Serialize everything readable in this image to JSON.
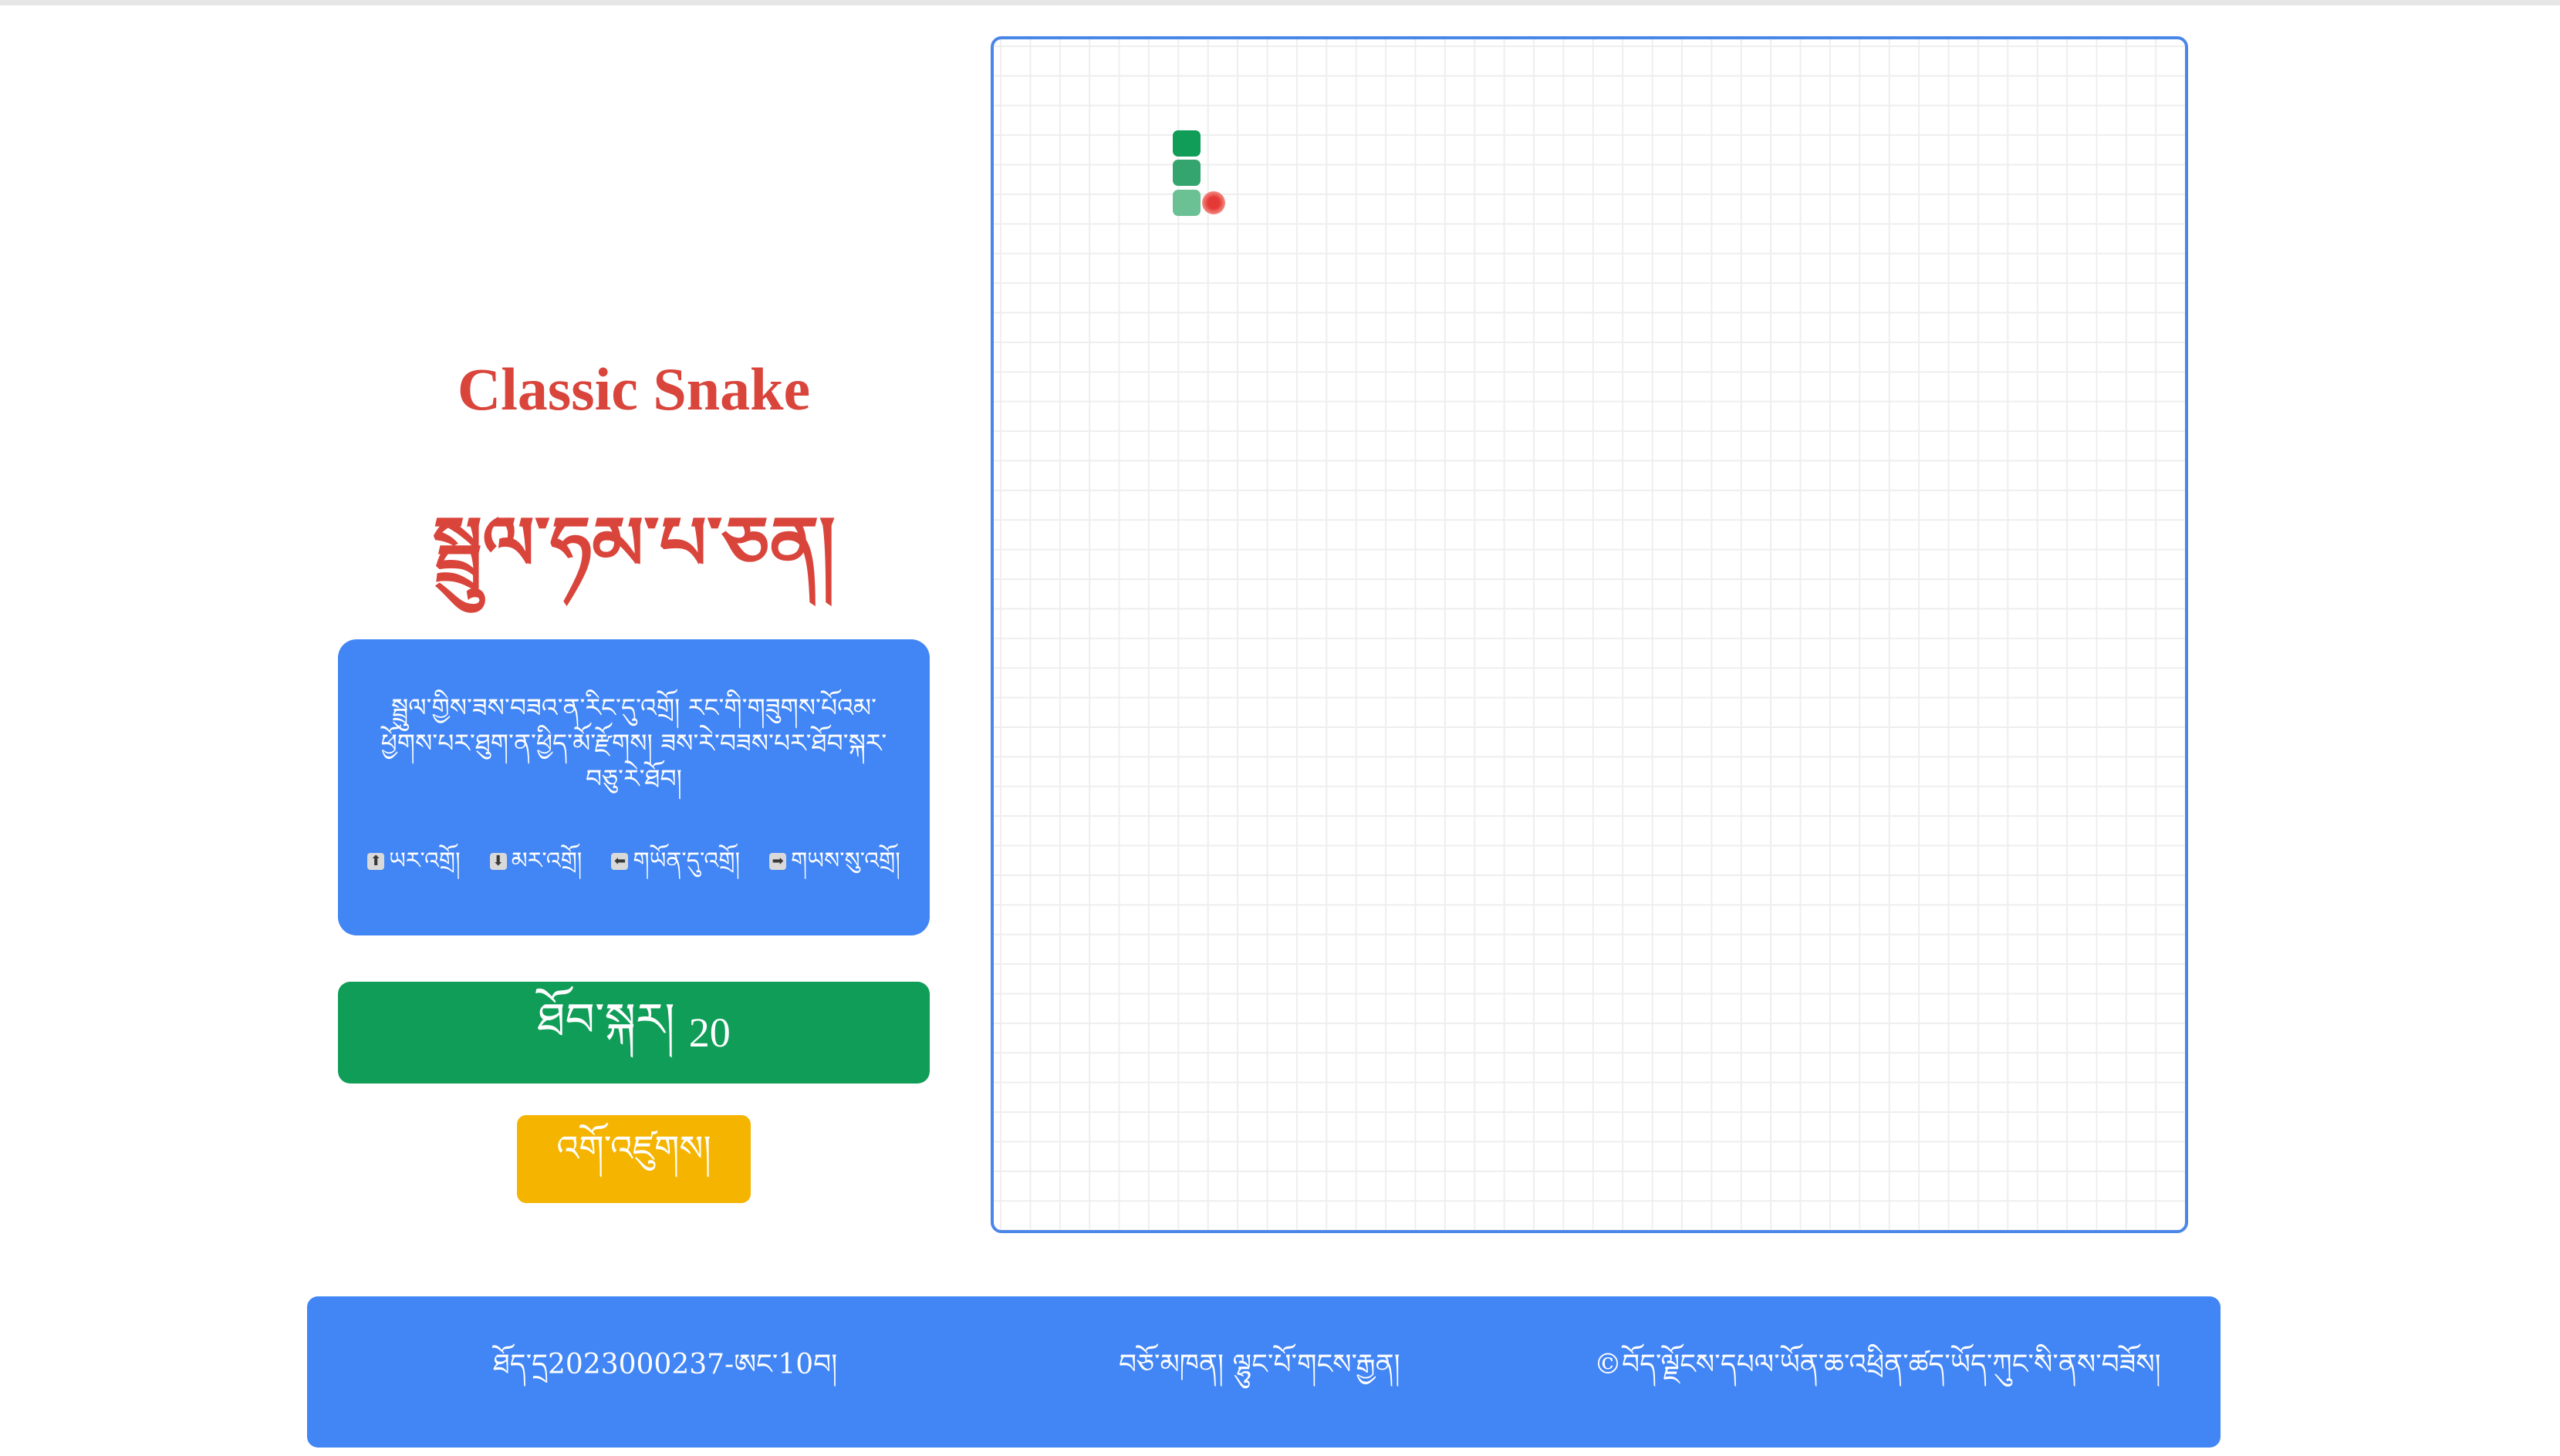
{
  "title_en": "Classic Snake",
  "title_bo": "སྦྲུལ་ཧམ་པ་ཅན།",
  "info": {
    "instructions": "སྦྲུལ་གྱིས་ཟས་བཟའ་ན་རིང་དུ་འགྲོ། རང་གི་གཟུགས་པོའམ་ཕྱོགས་པར་ཐུག་ན་ཕྱིད་མོ་རྫོགས། ཟས་རེ་བཟས་པར་ཐོབ་སྐར་བཅུ་རེ་ཐོབ།",
    "controls": [
      {
        "icon": "arrow-up-icon",
        "glyph": "⬆",
        "label": "ཡར་འགྲོ།"
      },
      {
        "icon": "arrow-down-icon",
        "glyph": "⬇",
        "label": "མར་འགྲོ།"
      },
      {
        "icon": "arrow-left-icon",
        "glyph": "⬅",
        "label": "གཡོན་དུ་འགྲོ།"
      },
      {
        "icon": "arrow-right-icon",
        "glyph": "➡",
        "label": "གཡས་སུ་འགྲོ།"
      }
    ]
  },
  "score": {
    "label": "ཐོབ་སྐར།",
    "value": "20"
  },
  "start_button": "འགོ་འཛུགས།",
  "game": {
    "grid_cells": 40,
    "snake": [
      {
        "col": 6,
        "row": 3
      },
      {
        "col": 6,
        "row": 4
      },
      {
        "col": 6,
        "row": 5
      }
    ],
    "food": {
      "col": 7,
      "row": 5
    },
    "colors": {
      "snake_head": "#0f9d58",
      "snake_body": "#34a56e",
      "snake_tail": "#6cc194",
      "food": "#e53935",
      "grid_line": "#eeeeee",
      "board_border": "#4a86e8"
    }
  },
  "footer": {
    "student_id": "ཐོད་དྲ2023000237-ཨང་10བ།",
    "teacher": "བཅོ་མཁན། ལྷུང་པོ་གངས་རྒྱན།",
    "copyright": "©བོད་ལྗོངས་དཔལ་ཡོན་ཆ་འཕྲིན་ཚད་ཡོད་ཀུང་སི་ནས་བཟོས།"
  },
  "theme": {
    "blue": "#4285f4",
    "green": "#0f9d58",
    "yellow": "#f4b400",
    "red": "#d9443b"
  }
}
